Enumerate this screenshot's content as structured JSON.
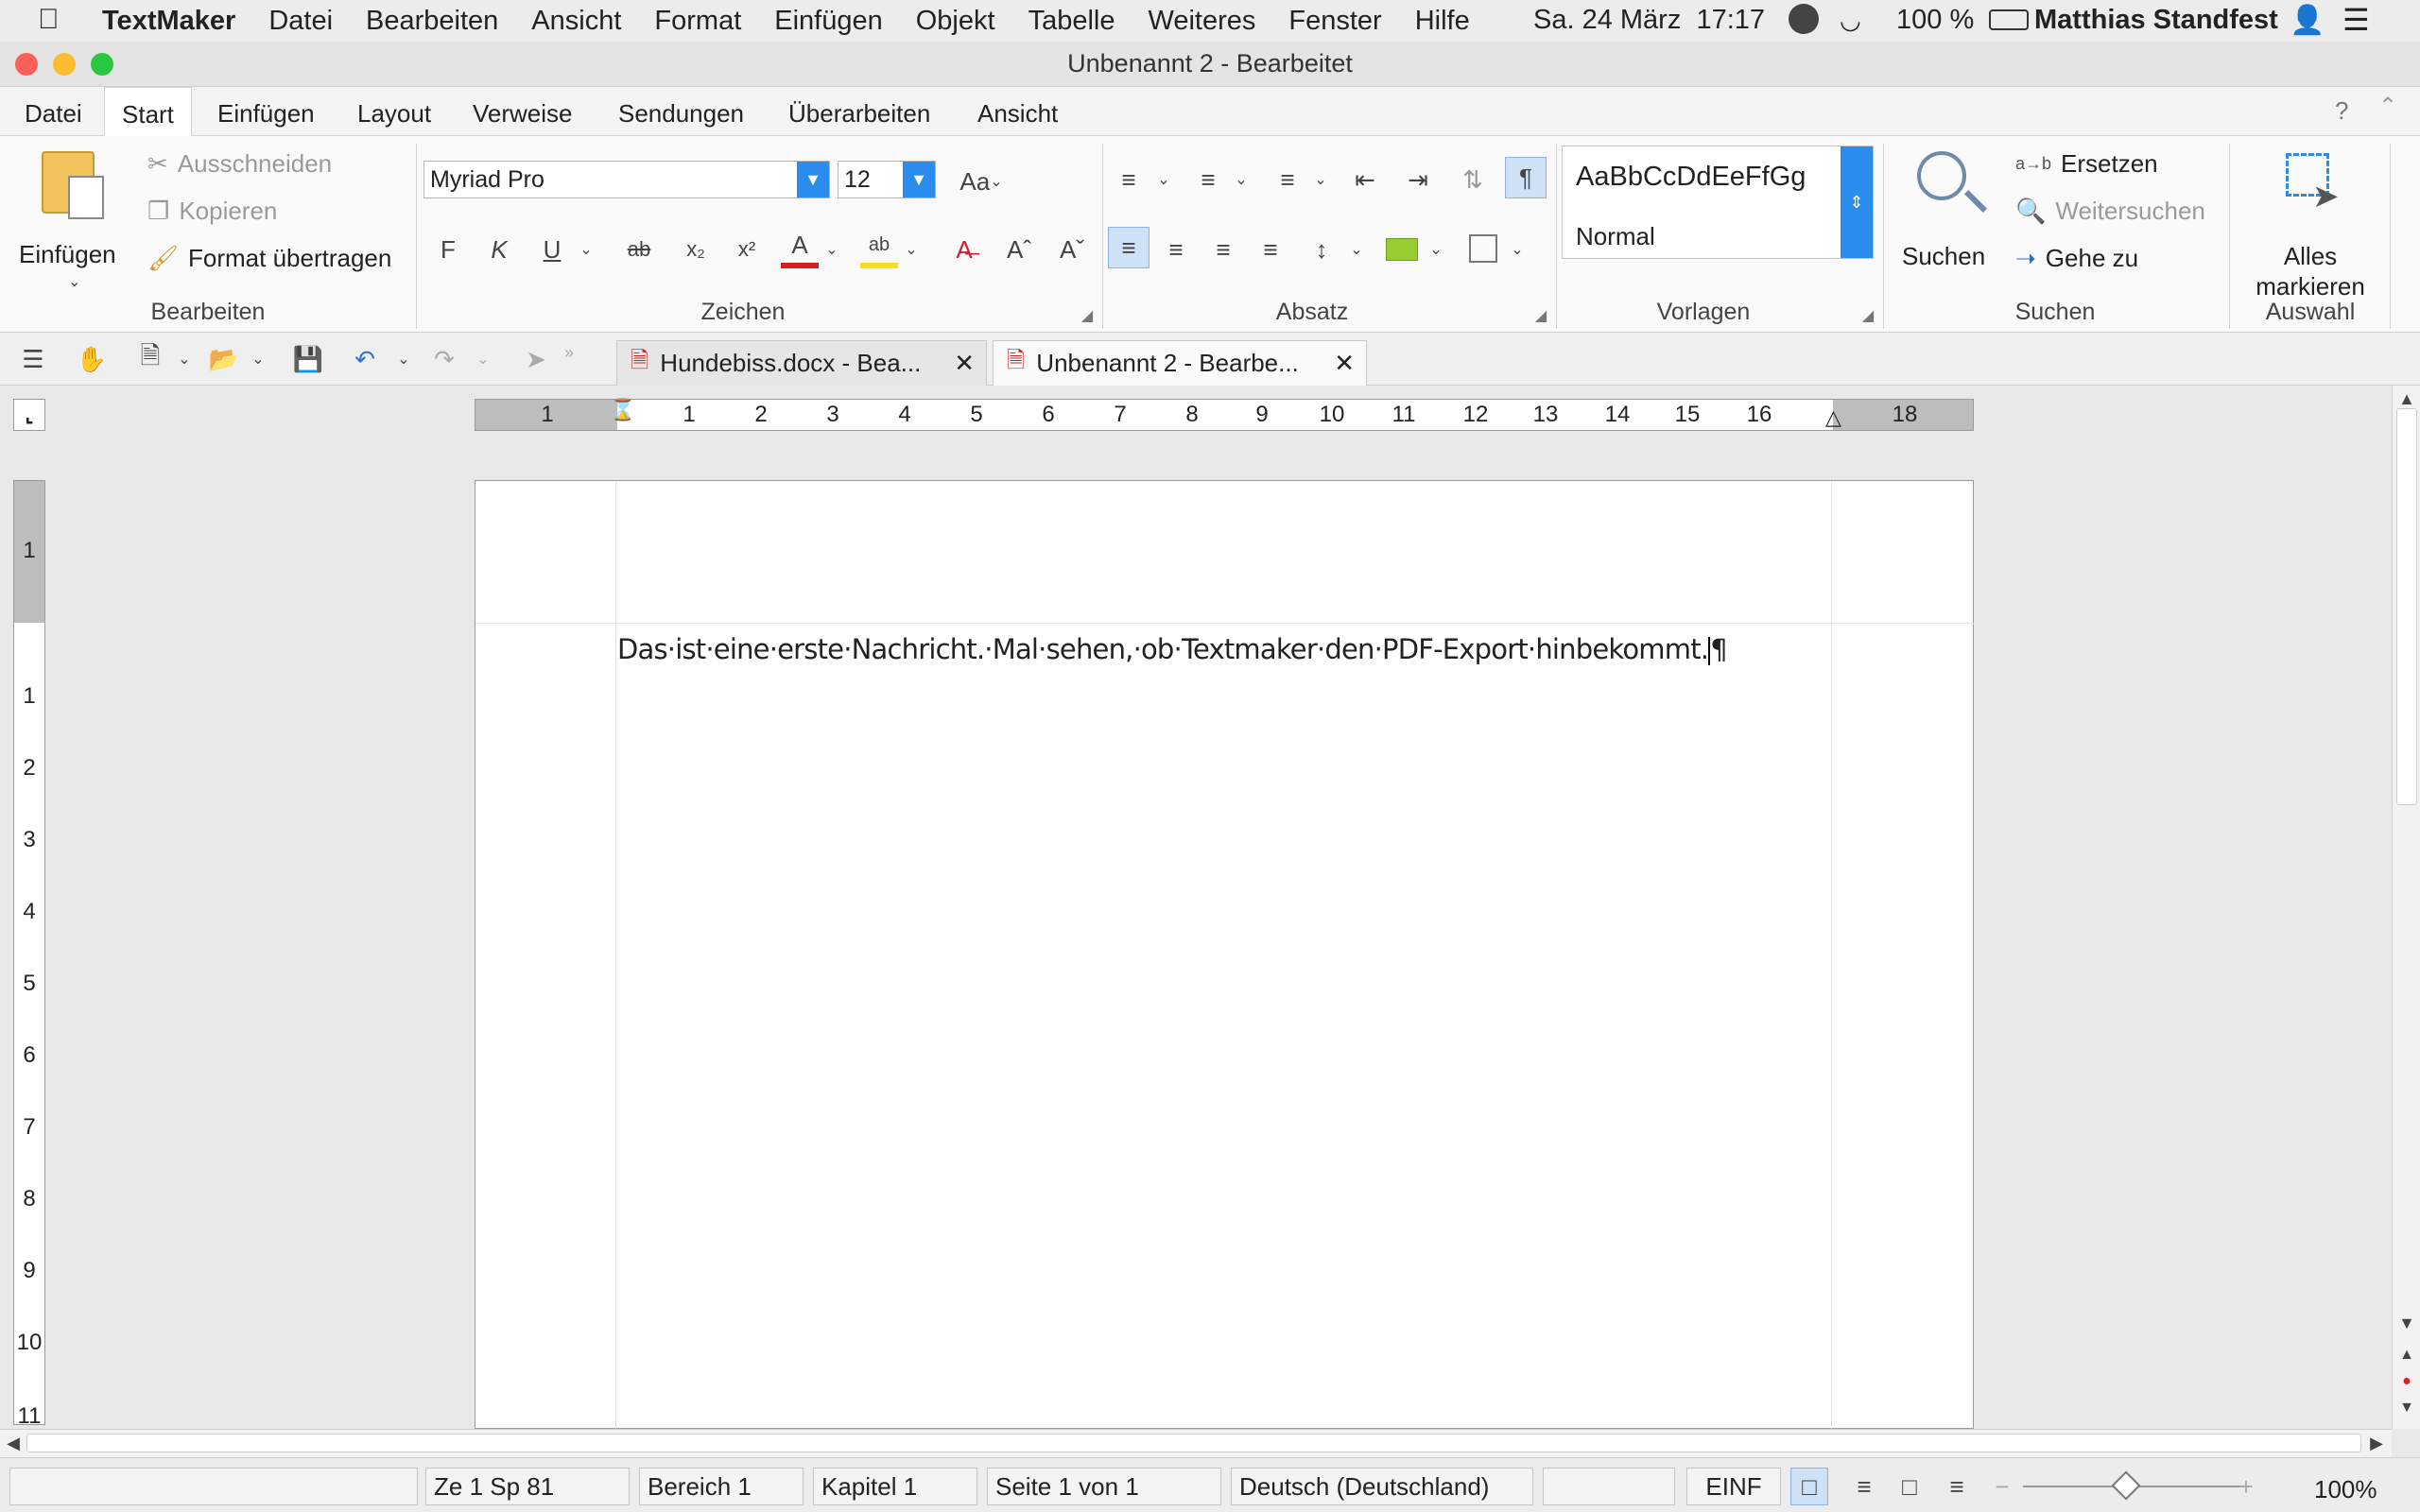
{
  "menubar": {
    "app": "TextMaker",
    "items": [
      "Datei",
      "Bearbeiten",
      "Ansicht",
      "Format",
      "Einfügen",
      "Objekt",
      "Tabelle",
      "Weiteres",
      "Fenster",
      "Hilfe"
    ],
    "datetime": "Sa. 24 März  17:17",
    "battery": "100 %",
    "user": "Matthias Standfest"
  },
  "window": {
    "title": "Unbenannt 2 - Bearbeitet"
  },
  "ribbon_tabs": [
    "Datei",
    "Start",
    "Einfügen",
    "Layout",
    "Verweise",
    "Sendungen",
    "Überarbeiten",
    "Ansicht"
  ],
  "help": "?",
  "ribbon": {
    "paste": "Einfügen",
    "cut": "Ausschneiden",
    "copy": "Kopieren",
    "format_painter": "Format übertragen",
    "group_edit": "Bearbeiten",
    "font_name": "Myriad Pro",
    "font_size": "12",
    "bold": "F",
    "italic": "K",
    "underline": "U",
    "group_font": "Zeichen",
    "group_paragraph": "Absatz",
    "style_preview": "AaBbCcDdEeFfGg",
    "style_name": "Normal",
    "group_styles": "Vorlagen",
    "search": "Suchen",
    "replace": "Ersetzen",
    "find_next": "Weitersuchen",
    "goto": "Gehe zu",
    "group_search": "Suchen",
    "select_all_1": "Alles",
    "select_all_2": "markieren",
    "group_selection": "Auswahl"
  },
  "doc_tabs": [
    {
      "label": "Hundebiss.docx - Bea..."
    },
    {
      "label": "Unbenannt 2 - Bearbe..."
    }
  ],
  "ruler": {
    "h_labels": [
      "1",
      "1",
      "2",
      "3",
      "4",
      "5",
      "6",
      "7",
      "8",
      "9",
      "10",
      "11",
      "12",
      "13",
      "14",
      "15",
      "16",
      "18"
    ],
    "v_labels": [
      "1",
      "1",
      "2",
      "3",
      "4",
      "5",
      "6",
      "7",
      "8",
      "9",
      "10",
      "11"
    ]
  },
  "document": {
    "text": "Das·ist·eine·erste·Nachricht.·Mal·sehen,·ob·Textmaker·den·PDF-Export·hinbekommt.",
    "pilcrow": "¶"
  },
  "status": {
    "position": "Ze 1 Sp 81",
    "section": "Bereich 1",
    "chapter": "Kapitel 1",
    "page": "Seite 1 von 1",
    "language": "Deutsch (Deutschland)",
    "mode": "EINF",
    "zoom": "100%"
  },
  "colors": {
    "accent": "#2a8cef",
    "close_red": "#fc5f57",
    "min_yellow": "#fdbc2e",
    "max_green": "#28c840"
  }
}
